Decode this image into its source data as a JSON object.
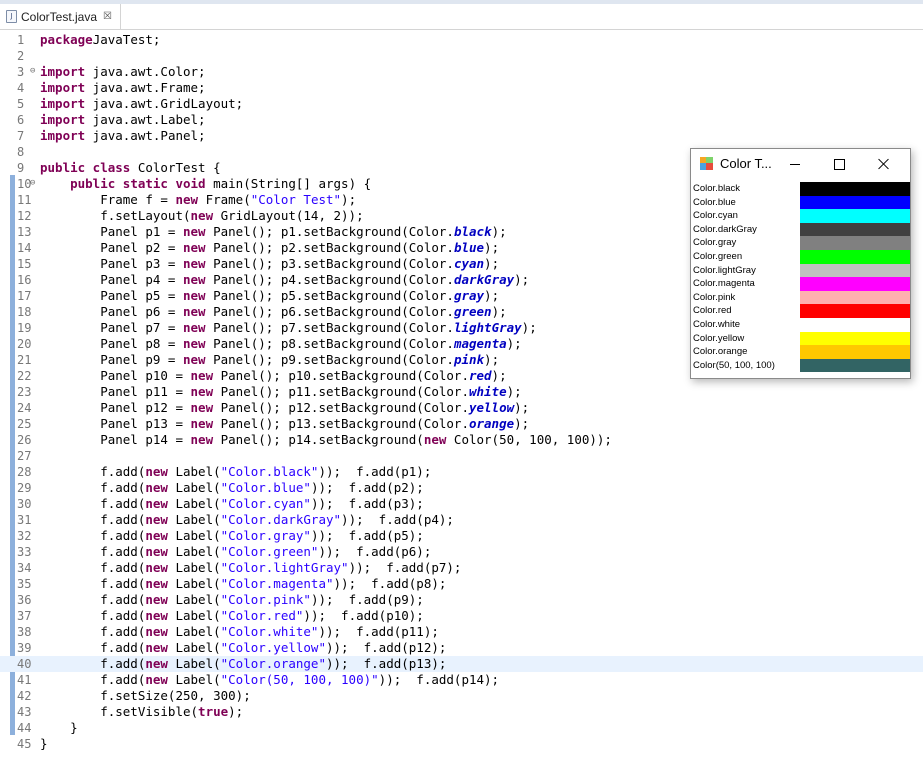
{
  "tab": {
    "title": "ColorTest.java",
    "close_glyph": "☒"
  },
  "editor": {
    "current_line": 40,
    "lines": [
      {
        "n": "1",
        "fold": "",
        "tokens": [
          [
            "kw",
            "package"
          ],
          [
            "",
            "JavaTest;"
          ]
        ]
      },
      {
        "n": "2",
        "fold": "",
        "tokens": []
      },
      {
        "n": "3",
        "fold": "⊖",
        "tokens": [
          [
            "kw",
            "import"
          ],
          [
            "",
            " java.awt.Color;"
          ]
        ]
      },
      {
        "n": "4",
        "fold": "",
        "tokens": [
          [
            "kw",
            "import"
          ],
          [
            "",
            " java.awt.Frame;"
          ]
        ]
      },
      {
        "n": "5",
        "fold": "",
        "tokens": [
          [
            "kw",
            "import"
          ],
          [
            "",
            " java.awt.GridLayout;"
          ]
        ]
      },
      {
        "n": "6",
        "fold": "",
        "tokens": [
          [
            "kw",
            "import"
          ],
          [
            "",
            " java.awt.Label;"
          ]
        ]
      },
      {
        "n": "7",
        "fold": "",
        "tokens": [
          [
            "kw",
            "import"
          ],
          [
            "",
            " java.awt.Panel;"
          ]
        ]
      },
      {
        "n": "8",
        "fold": "",
        "tokens": []
      },
      {
        "n": "9",
        "fold": "",
        "tokens": [
          [
            "kw",
            "public class"
          ],
          [
            "",
            " ColorTest {"
          ]
        ]
      },
      {
        "n": "10",
        "fold": "⊖",
        "tokens": [
          [
            "",
            "    "
          ],
          [
            "kw",
            "public static void"
          ],
          [
            "",
            " main(String[] args) {"
          ]
        ]
      },
      {
        "n": "11",
        "fold": "",
        "tokens": [
          [
            "",
            "        Frame f = "
          ],
          [
            "kw",
            "new"
          ],
          [
            "",
            " Frame("
          ],
          [
            "str",
            "\"Color Test\""
          ],
          [
            "",
            ");"
          ]
        ]
      },
      {
        "n": "12",
        "fold": "",
        "tokens": [
          [
            "",
            "        f.setLayout("
          ],
          [
            "kw",
            "new"
          ],
          [
            "",
            " GridLayout(14, 2));"
          ]
        ]
      },
      {
        "n": "13",
        "fold": "",
        "tokens": [
          [
            "",
            "        Panel p1 = "
          ],
          [
            "kw",
            "new"
          ],
          [
            "",
            " Panel(); p1.setBackground(Color."
          ],
          [
            "fld",
            "black"
          ],
          [
            "",
            ");"
          ]
        ]
      },
      {
        "n": "14",
        "fold": "",
        "tokens": [
          [
            "",
            "        Panel p2 = "
          ],
          [
            "kw",
            "new"
          ],
          [
            "",
            " Panel(); p2.setBackground(Color."
          ],
          [
            "fld",
            "blue"
          ],
          [
            "",
            ");"
          ]
        ]
      },
      {
        "n": "15",
        "fold": "",
        "tokens": [
          [
            "",
            "        Panel p3 = "
          ],
          [
            "kw",
            "new"
          ],
          [
            "",
            " Panel(); p3.setBackground(Color."
          ],
          [
            "fld",
            "cyan"
          ],
          [
            "",
            ");"
          ]
        ]
      },
      {
        "n": "16",
        "fold": "",
        "tokens": [
          [
            "",
            "        Panel p4 = "
          ],
          [
            "kw",
            "new"
          ],
          [
            "",
            " Panel(); p4.setBackground(Color."
          ],
          [
            "fld",
            "darkGray"
          ],
          [
            "",
            ");"
          ]
        ]
      },
      {
        "n": "17",
        "fold": "",
        "tokens": [
          [
            "",
            "        Panel p5 = "
          ],
          [
            "kw",
            "new"
          ],
          [
            "",
            " Panel(); p5.setBackground(Color."
          ],
          [
            "fld",
            "gray"
          ],
          [
            "",
            ");"
          ]
        ]
      },
      {
        "n": "18",
        "fold": "",
        "tokens": [
          [
            "",
            "        Panel p6 = "
          ],
          [
            "kw",
            "new"
          ],
          [
            "",
            " Panel(); p6.setBackground(Color."
          ],
          [
            "fld",
            "green"
          ],
          [
            "",
            ");"
          ]
        ]
      },
      {
        "n": "19",
        "fold": "",
        "tokens": [
          [
            "",
            "        Panel p7 = "
          ],
          [
            "kw",
            "new"
          ],
          [
            "",
            " Panel(); p7.setBackground(Color."
          ],
          [
            "fld",
            "lightGray"
          ],
          [
            "",
            ");"
          ]
        ]
      },
      {
        "n": "20",
        "fold": "",
        "tokens": [
          [
            "",
            "        Panel p8 = "
          ],
          [
            "kw",
            "new"
          ],
          [
            "",
            " Panel(); p8.setBackground(Color."
          ],
          [
            "fld",
            "magenta"
          ],
          [
            "",
            ");"
          ]
        ]
      },
      {
        "n": "21",
        "fold": "",
        "tokens": [
          [
            "",
            "        Panel p9 = "
          ],
          [
            "kw",
            "new"
          ],
          [
            "",
            " Panel(); p9.setBackground(Color."
          ],
          [
            "fld",
            "pink"
          ],
          [
            "",
            ");"
          ]
        ]
      },
      {
        "n": "22",
        "fold": "",
        "tokens": [
          [
            "",
            "        Panel p10 = "
          ],
          [
            "kw",
            "new"
          ],
          [
            "",
            " Panel(); p10.setBackground(Color."
          ],
          [
            "fld",
            "red"
          ],
          [
            "",
            ");"
          ]
        ]
      },
      {
        "n": "23",
        "fold": "",
        "tokens": [
          [
            "",
            "        Panel p11 = "
          ],
          [
            "kw",
            "new"
          ],
          [
            "",
            " Panel(); p11.setBackground(Color."
          ],
          [
            "fld",
            "white"
          ],
          [
            "",
            ");"
          ]
        ]
      },
      {
        "n": "24",
        "fold": "",
        "tokens": [
          [
            "",
            "        Panel p12 = "
          ],
          [
            "kw",
            "new"
          ],
          [
            "",
            " Panel(); p12.setBackground(Color."
          ],
          [
            "fld",
            "yellow"
          ],
          [
            "",
            ");"
          ]
        ]
      },
      {
        "n": "25",
        "fold": "",
        "tokens": [
          [
            "",
            "        Panel p13 = "
          ],
          [
            "kw",
            "new"
          ],
          [
            "",
            " Panel(); p13.setBackground(Color."
          ],
          [
            "fld",
            "orange"
          ],
          [
            "",
            ");"
          ]
        ]
      },
      {
        "n": "26",
        "fold": "",
        "tokens": [
          [
            "",
            "        Panel p14 = "
          ],
          [
            "kw",
            "new"
          ],
          [
            "",
            " Panel(); p14.setBackground("
          ],
          [
            "kw",
            "new"
          ],
          [
            "",
            " Color(50, 100, 100));"
          ]
        ]
      },
      {
        "n": "27",
        "fold": "",
        "tokens": []
      },
      {
        "n": "28",
        "fold": "",
        "tokens": [
          [
            "",
            "        f.add("
          ],
          [
            "kw",
            "new"
          ],
          [
            "",
            " Label("
          ],
          [
            "str",
            "\"Color.black\""
          ],
          [
            "",
            "));  f.add(p1);"
          ]
        ]
      },
      {
        "n": "29",
        "fold": "",
        "tokens": [
          [
            "",
            "        f.add("
          ],
          [
            "kw",
            "new"
          ],
          [
            "",
            " Label("
          ],
          [
            "str",
            "\"Color.blue\""
          ],
          [
            "",
            "));  f.add(p2);"
          ]
        ]
      },
      {
        "n": "30",
        "fold": "",
        "tokens": [
          [
            "",
            "        f.add("
          ],
          [
            "kw",
            "new"
          ],
          [
            "",
            " Label("
          ],
          [
            "str",
            "\"Color.cyan\""
          ],
          [
            "",
            "));  f.add(p3);"
          ]
        ]
      },
      {
        "n": "31",
        "fold": "",
        "tokens": [
          [
            "",
            "        f.add("
          ],
          [
            "kw",
            "new"
          ],
          [
            "",
            " Label("
          ],
          [
            "str",
            "\"Color.darkGray\""
          ],
          [
            "",
            "));  f.add(p4);"
          ]
        ]
      },
      {
        "n": "32",
        "fold": "",
        "tokens": [
          [
            "",
            "        f.add("
          ],
          [
            "kw",
            "new"
          ],
          [
            "",
            " Label("
          ],
          [
            "str",
            "\"Color.gray\""
          ],
          [
            "",
            "));  f.add(p5);"
          ]
        ]
      },
      {
        "n": "33",
        "fold": "",
        "tokens": [
          [
            "",
            "        f.add("
          ],
          [
            "kw",
            "new"
          ],
          [
            "",
            " Label("
          ],
          [
            "str",
            "\"Color.green\""
          ],
          [
            "",
            "));  f.add(p6);"
          ]
        ]
      },
      {
        "n": "34",
        "fold": "",
        "tokens": [
          [
            "",
            "        f.add("
          ],
          [
            "kw",
            "new"
          ],
          [
            "",
            " Label("
          ],
          [
            "str",
            "\"Color.lightGray\""
          ],
          [
            "",
            "));  f.add(p7);"
          ]
        ]
      },
      {
        "n": "35",
        "fold": "",
        "tokens": [
          [
            "",
            "        f.add("
          ],
          [
            "kw",
            "new"
          ],
          [
            "",
            " Label("
          ],
          [
            "str",
            "\"Color.magenta\""
          ],
          [
            "",
            "));  f.add(p8);"
          ]
        ]
      },
      {
        "n": "36",
        "fold": "",
        "tokens": [
          [
            "",
            "        f.add("
          ],
          [
            "kw",
            "new"
          ],
          [
            "",
            " Label("
          ],
          [
            "str",
            "\"Color.pink\""
          ],
          [
            "",
            "));  f.add(p9);"
          ]
        ]
      },
      {
        "n": "37",
        "fold": "",
        "tokens": [
          [
            "",
            "        f.add("
          ],
          [
            "kw",
            "new"
          ],
          [
            "",
            " Label("
          ],
          [
            "str",
            "\"Color.red\""
          ],
          [
            "",
            "));  f.add(p10);"
          ]
        ]
      },
      {
        "n": "38",
        "fold": "",
        "tokens": [
          [
            "",
            "        f.add("
          ],
          [
            "kw",
            "new"
          ],
          [
            "",
            " Label("
          ],
          [
            "str",
            "\"Color.white\""
          ],
          [
            "",
            "));  f.add(p11);"
          ]
        ]
      },
      {
        "n": "39",
        "fold": "",
        "tokens": [
          [
            "",
            "        f.add("
          ],
          [
            "kw",
            "new"
          ],
          [
            "",
            " Label("
          ],
          [
            "str",
            "\"Color.yellow\""
          ],
          [
            "",
            "));  f.add(p12);"
          ]
        ]
      },
      {
        "n": "40",
        "fold": "",
        "tokens": [
          [
            "",
            "        f.add("
          ],
          [
            "kw",
            "new"
          ],
          [
            "",
            " Label("
          ],
          [
            "str",
            "\"Color.orange\""
          ],
          [
            "",
            "));  f.add(p13);"
          ]
        ]
      },
      {
        "n": "41",
        "fold": "",
        "tokens": [
          [
            "",
            "        f.add("
          ],
          [
            "kw",
            "new"
          ],
          [
            "",
            " Label("
          ],
          [
            "str",
            "\"Color(50, 100, 100)\""
          ],
          [
            "",
            "));  f.add(p14);"
          ]
        ]
      },
      {
        "n": "42",
        "fold": "",
        "tokens": [
          [
            "",
            "        f.setSize(250, 300);"
          ]
        ]
      },
      {
        "n": "43",
        "fold": "",
        "tokens": [
          [
            "",
            "        f.setVisible("
          ],
          [
            "kw",
            "true"
          ],
          [
            "",
            ");"
          ]
        ]
      },
      {
        "n": "44",
        "fold": "",
        "tokens": [
          [
            "",
            "    }"
          ]
        ]
      },
      {
        "n": "45",
        "fold": "",
        "tokens": [
          [
            "",
            "}"
          ]
        ]
      }
    ]
  },
  "app_window": {
    "title": "Color T...",
    "icon": "awt-frame-icon",
    "buttons": {
      "minimize": "minimize-icon",
      "maximize": "maximize-icon",
      "close": "close-icon"
    },
    "rows": [
      {
        "label": "Color.black",
        "color": "#000000"
      },
      {
        "label": "Color.blue",
        "color": "#0000ff"
      },
      {
        "label": "Color.cyan",
        "color": "#00ffff"
      },
      {
        "label": "Color.darkGray",
        "color": "#404040"
      },
      {
        "label": "Color.gray",
        "color": "#808080"
      },
      {
        "label": "Color.green",
        "color": "#00ff00"
      },
      {
        "label": "Color.lightGray",
        "color": "#c0c0c0"
      },
      {
        "label": "Color.magenta",
        "color": "#ff00ff"
      },
      {
        "label": "Color.pink",
        "color": "#ffafaf"
      },
      {
        "label": "Color.red",
        "color": "#ff0000"
      },
      {
        "label": "Color.white",
        "color": "#ffffff"
      },
      {
        "label": "Color.yellow",
        "color": "#ffff00"
      },
      {
        "label": "Color.orange",
        "color": "#ffc800"
      },
      {
        "label": "Color(50, 100, 100)",
        "color": "#326464"
      }
    ]
  }
}
